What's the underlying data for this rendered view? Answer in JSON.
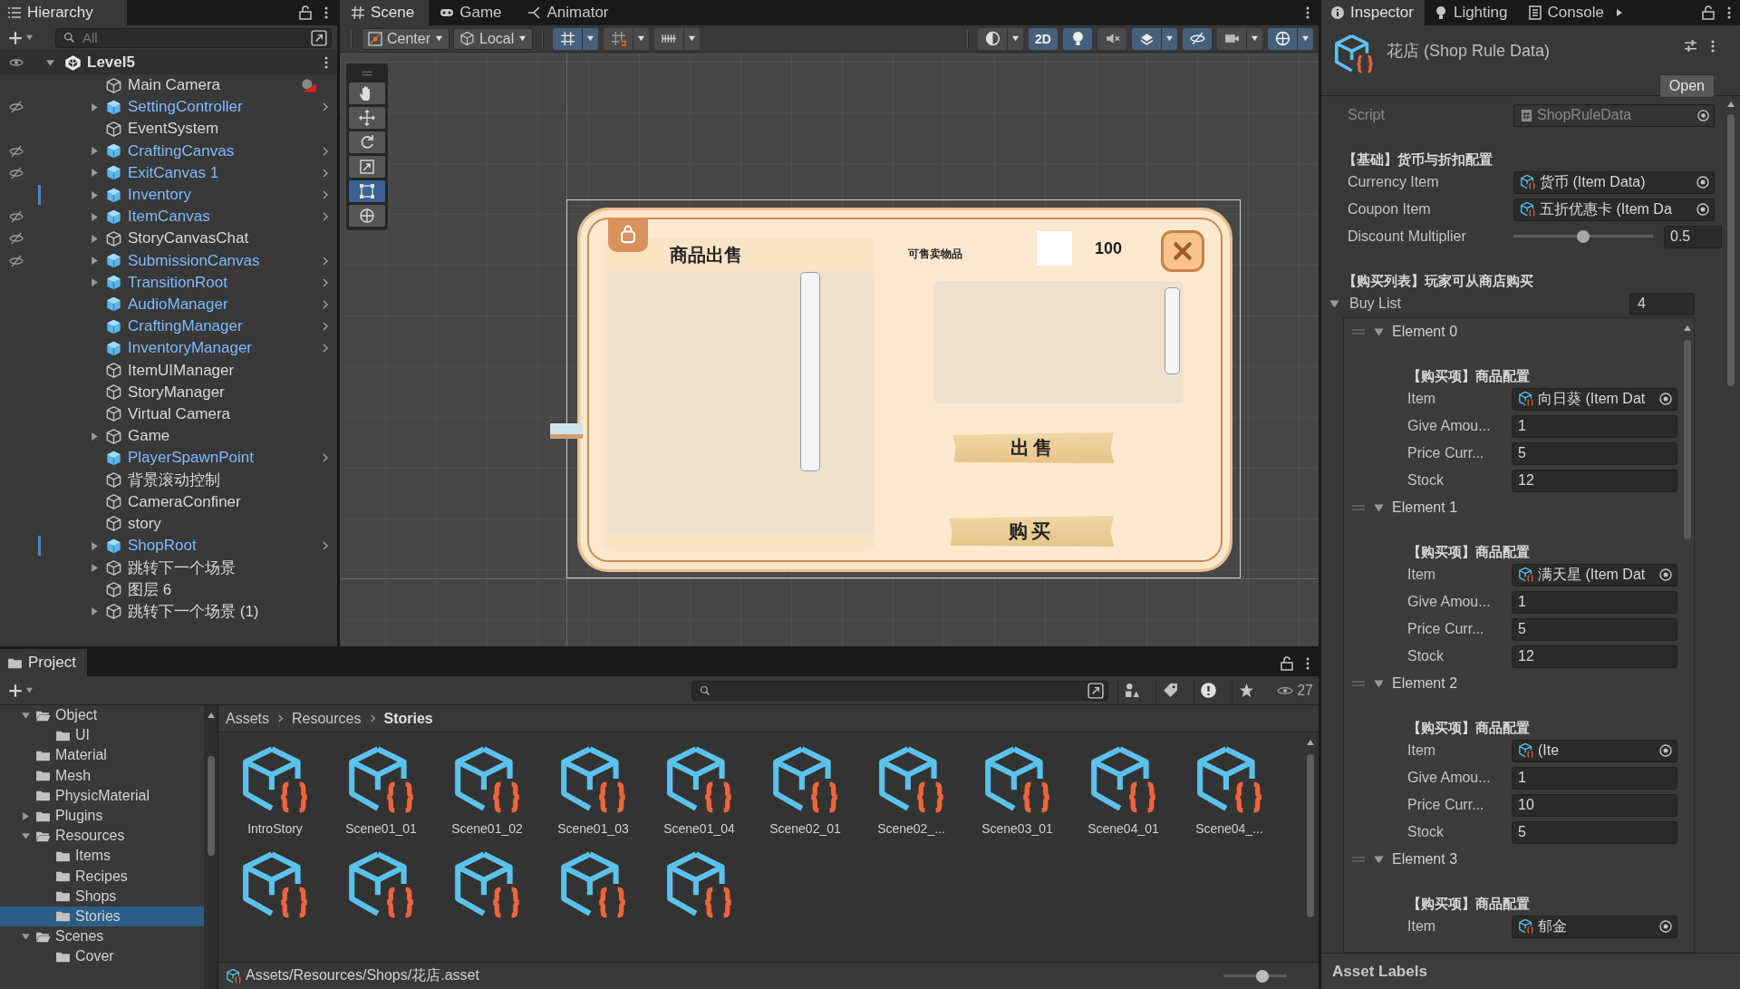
{
  "hierarchy": {
    "title": "Hierarchy",
    "search": {
      "placeholder": "All"
    },
    "scene": "Level5",
    "items": [
      {
        "name": "Main Camera",
        "prefab": false,
        "foldout": false,
        "hidden": false,
        "modified": false,
        "gizmo": true
      },
      {
        "name": "SettingController",
        "prefab": true,
        "foldout": true,
        "hidden": true,
        "modified": false,
        "gizmo": false
      },
      {
        "name": "EventSystem",
        "prefab": false,
        "foldout": false,
        "hidden": false,
        "modified": false,
        "gizmo": false
      },
      {
        "name": "CraftingCanvas",
        "prefab": true,
        "foldout": true,
        "hidden": true,
        "modified": false,
        "gizmo": false
      },
      {
        "name": "ExitCanvas 1",
        "prefab": true,
        "foldout": true,
        "hidden": true,
        "modified": false,
        "gizmo": false
      },
      {
        "name": "Inventory",
        "prefab": true,
        "foldout": true,
        "hidden": false,
        "modified": true,
        "gizmo": false
      },
      {
        "name": "ItemCanvas",
        "prefab": true,
        "foldout": true,
        "hidden": true,
        "modified": false,
        "gizmo": false
      },
      {
        "name": "StoryCanvasChat",
        "prefab": false,
        "foldout": true,
        "hidden": true,
        "modified": false,
        "gizmo": false
      },
      {
        "name": "SubmissionCanvas",
        "prefab": true,
        "foldout": true,
        "hidden": true,
        "modified": false,
        "gizmo": false
      },
      {
        "name": "TransitionRoot",
        "prefab": true,
        "foldout": true,
        "hidden": false,
        "modified": false,
        "gizmo": false
      },
      {
        "name": "AudioManager",
        "prefab": true,
        "foldout": false,
        "hidden": false,
        "modified": false,
        "gizmo": false
      },
      {
        "name": "CraftingManager",
        "prefab": true,
        "foldout": false,
        "hidden": false,
        "modified": false,
        "gizmo": false
      },
      {
        "name": "InventoryManager",
        "prefab": true,
        "foldout": false,
        "hidden": false,
        "modified": false,
        "gizmo": false
      },
      {
        "name": "ItemUIManager",
        "prefab": false,
        "foldout": false,
        "hidden": false,
        "modified": false,
        "gizmo": false
      },
      {
        "name": "StoryManager",
        "prefab": false,
        "foldout": false,
        "hidden": false,
        "modified": false,
        "gizmo": false
      },
      {
        "name": "Virtual Camera",
        "prefab": false,
        "foldout": false,
        "hidden": false,
        "modified": false,
        "gizmo": false
      },
      {
        "name": "Game",
        "prefab": false,
        "foldout": true,
        "hidden": false,
        "modified": false,
        "gizmo": false
      },
      {
        "name": "PlayerSpawnPoint",
        "prefab": true,
        "foldout": false,
        "hidden": false,
        "modified": false,
        "gizmo": false
      },
      {
        "name": "背景滚动控制",
        "prefab": false,
        "foldout": false,
        "hidden": false,
        "modified": false,
        "gizmo": false
      },
      {
        "name": "CameraConfiner",
        "prefab": false,
        "foldout": false,
        "hidden": false,
        "modified": false,
        "gizmo": false
      },
      {
        "name": "story",
        "prefab": false,
        "foldout": false,
        "hidden": false,
        "modified": false,
        "gizmo": false
      },
      {
        "name": "ShopRoot",
        "prefab": true,
        "foldout": true,
        "hidden": false,
        "modified": true,
        "gizmo": false
      },
      {
        "name": "跳转下一个场景",
        "prefab": false,
        "foldout": true,
        "hidden": false,
        "modified": false,
        "gizmo": false
      },
      {
        "name": "图层 6",
        "prefab": false,
        "foldout": false,
        "hidden": false,
        "modified": false,
        "gizmo": false
      },
      {
        "name": "跳转下一个场景 (1)",
        "prefab": false,
        "foldout": true,
        "hidden": false,
        "modified": false,
        "gizmo": false
      }
    ]
  },
  "scene": {
    "tabs": [
      {
        "label": "Scene",
        "kind": "scene",
        "selected": true
      },
      {
        "label": "Game",
        "kind": "game",
        "selected": false
      },
      {
        "label": "Animator",
        "kind": "animator",
        "selected": false
      }
    ],
    "pivot": "Center",
    "space": "Local",
    "toggles_left": [
      {
        "kind": "grid",
        "on": true,
        "dropdown": true
      },
      {
        "kind": "snap",
        "on": false,
        "dropdown": true
      },
      {
        "kind": "increment",
        "on": false,
        "dropdown": true
      }
    ],
    "toggles_right": [
      {
        "kind": "shading",
        "on": false,
        "dropdown": true
      },
      {
        "kind": "mode",
        "label": "2D",
        "on": true,
        "dropdown": false
      },
      {
        "kind": "lighting",
        "on": true,
        "dropdown": false
      },
      {
        "kind": "audio",
        "on": false,
        "dropdown": false
      },
      {
        "kind": "effects",
        "on": true,
        "dropdown": true
      },
      {
        "kind": "visibility",
        "on": true,
        "dropdown": false
      },
      {
        "kind": "camera",
        "on": false,
        "dropdown": true
      },
      {
        "kind": "gizmos",
        "on": true,
        "dropdown": true
      }
    ],
    "tools": [
      {
        "kind": "hand",
        "selected": false
      },
      {
        "kind": "move",
        "selected": false
      },
      {
        "kind": "rotate",
        "selected": false
      },
      {
        "kind": "scale",
        "selected": false
      },
      {
        "kind": "rect",
        "selected": true
      },
      {
        "kind": "transform",
        "selected": false
      }
    ],
    "shop_ui": {
      "title": "商品出售",
      "sell_label": "可售卖物品",
      "amount": "100",
      "sell_button": "出售",
      "buy_button": "购买"
    }
  },
  "inspector": {
    "tabs": [
      {
        "label": "Inspector",
        "kind": "info",
        "selected": true
      },
      {
        "label": "Lighting",
        "kind": "bulb",
        "selected": false
      },
      {
        "label": "Console",
        "kind": "console",
        "selected": false
      }
    ],
    "title": "花店 (Shop Rule Data)",
    "open_button": "Open",
    "script": {
      "label": "Script",
      "value": "ShopRuleData",
      "disabled": true
    },
    "basic_header": "【基础】货币与折扣配置",
    "currency": {
      "label": "Currency Item",
      "value": "货币 (Item Data)"
    },
    "coupon": {
      "label": "Coupon Item",
      "value": "五折优惠卡 (Item Da"
    },
    "discount": {
      "label": "Discount Multiplier",
      "level": 0.5,
      "value": "0.5"
    },
    "buy_header": "【购买列表】玩家可从商店购买",
    "buy_list": {
      "label": "Buy List",
      "expanded": true,
      "size": "4",
      "elements": [
        {
          "title": "Element 0",
          "expanded": true,
          "header": "【购买项】商品配置",
          "fields": [
            {
              "kind": "object",
              "label": "Item",
              "value": "向日葵 (Item Dat"
            },
            {
              "kind": "number",
              "label": "Give Amou...",
              "value": "1"
            },
            {
              "kind": "number",
              "label": "Price Curr...",
              "value": "5"
            },
            {
              "kind": "number",
              "label": "Stock",
              "value": "12"
            }
          ]
        },
        {
          "title": "Element 1",
          "expanded": true,
          "header": "【购买项】商品配置",
          "fields": [
            {
              "kind": "object",
              "label": "Item",
              "value": "满天星 (Item Dat"
            },
            {
              "kind": "number",
              "label": "Give Amou...",
              "value": "1"
            },
            {
              "kind": "number",
              "label": "Price Curr...",
              "value": "5"
            },
            {
              "kind": "number",
              "label": "Stock",
              "value": "12"
            }
          ]
        },
        {
          "title": "Element 2",
          "expanded": true,
          "header": "【购买项】商品配置",
          "fields": [
            {
              "kind": "object",
              "label": "Item",
              "value": "(Ite"
            },
            {
              "kind": "number",
              "label": "Give Amou...",
              "value": "1"
            },
            {
              "kind": "number",
              "label": "Price Curr...",
              "value": "10"
            },
            {
              "kind": "number",
              "label": "Stock",
              "value": "5"
            }
          ]
        },
        {
          "title": "Element 3",
          "expanded": true,
          "header": "【购买项】商品配置",
          "fields": [
            {
              "kind": "object",
              "label": "Item",
              "value": "郁金"
            }
          ]
        }
      ]
    },
    "footer": "Asset Labels"
  },
  "project": {
    "title": "Project",
    "count": "27",
    "tree": [
      {
        "name": "Object",
        "expanded": true,
        "selected": false,
        "children": [
          {
            "name": "UI",
            "selected": false
          }
        ]
      },
      {
        "name": "Material",
        "selected": false
      },
      {
        "name": "Mesh",
        "selected": false
      },
      {
        "name": "PhysicMaterial",
        "selected": false
      },
      {
        "name": "Plugins",
        "expanded": false,
        "selected": false
      },
      {
        "name": "Resources",
        "expanded": true,
        "selected": false,
        "children": [
          {
            "name": "Items",
            "selected": false
          },
          {
            "name": "Recipes",
            "selected": false
          },
          {
            "name": "Shops",
            "selected": false
          },
          {
            "name": "Stories",
            "selected": true
          }
        ]
      },
      {
        "name": "Scenes",
        "expanded": true,
        "selected": false,
        "children": [
          {
            "name": "Cover",
            "selected": false
          }
        ]
      }
    ],
    "breadcrumb": [
      "Assets",
      "Resources",
      "Stories"
    ],
    "assets": [
      {
        "kind": "script_asset",
        "name": "IntroStory"
      },
      {
        "kind": "script_asset",
        "name": "Scene01_01"
      },
      {
        "kind": "script_asset",
        "name": "Scene01_02"
      },
      {
        "kind": "script_asset",
        "name": "Scene01_03"
      },
      {
        "kind": "script_asset",
        "name": "Scene01_04"
      },
      {
        "kind": "script_asset",
        "name": "Scene02_01"
      },
      {
        "kind": "script_asset",
        "name": "Scene02_..."
      },
      {
        "kind": "script_asset",
        "name": "Scene03_01"
      },
      {
        "kind": "script_asset",
        "name": "Scene04_01"
      },
      {
        "kind": "script_asset",
        "name": "Scene04_..."
      },
      {
        "kind": "script_asset"
      },
      {
        "kind": "script_asset"
      },
      {
        "kind": "script_asset"
      },
      {
        "kind": "script_asset"
      },
      {
        "kind": "script_asset"
      }
    ],
    "path": "Assets/Resources/Shops/花店.asset",
    "zoom": {
      "level": 0.6
    }
  }
}
